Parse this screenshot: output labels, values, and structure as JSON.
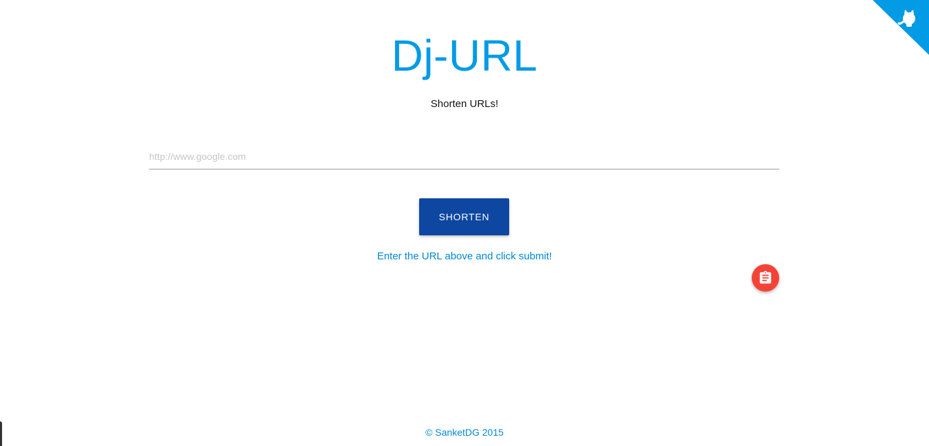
{
  "app": {
    "title": "Dj-URL",
    "tagline": "Shorten URLs!"
  },
  "form": {
    "url_placeholder": "http://www.google.com",
    "url_value": "",
    "submit_label": "SHORTEN"
  },
  "result": {
    "message": "Enter the URL above and click submit!"
  },
  "fab": {
    "icon": "clipboard-icon"
  },
  "corner": {
    "icon": "github-octocat-icon"
  },
  "footer": {
    "text": "© SanketDG 2015"
  },
  "colors": {
    "title": "#039be5",
    "button": "#0d47a1",
    "link": "#0288d1",
    "fab": "#f44336",
    "corner": "#039be5"
  }
}
